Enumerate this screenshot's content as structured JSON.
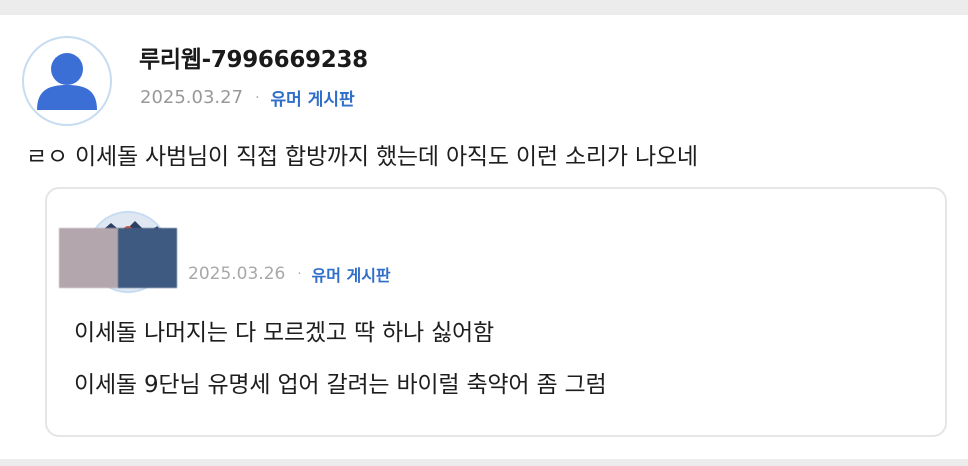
{
  "post": {
    "author": "루리웹-7996669238",
    "date": "2025.03.27",
    "separator": "·",
    "board": "유머 게시판",
    "text": "ㄹㅇ 이세돌 사범님이 직접 합방까지 했는데 아직도 이런 소리가 나오네",
    "avatar_icon": "default-user-icon"
  },
  "quoted": {
    "date": "2025.03.26",
    "separator": "·",
    "board": "유머 게시판",
    "lines": [
      "이세돌 나머지는 다 모르겠고 딱 하나 싫어함",
      "이세돌 9단님 유명세 업어 갈려는 바이럴 축약어 좀 그럼"
    ]
  },
  "colors": {
    "accent": "#2f6ec9",
    "avatar_blue": "#3b6fd6",
    "meta_gray": "#999999"
  }
}
